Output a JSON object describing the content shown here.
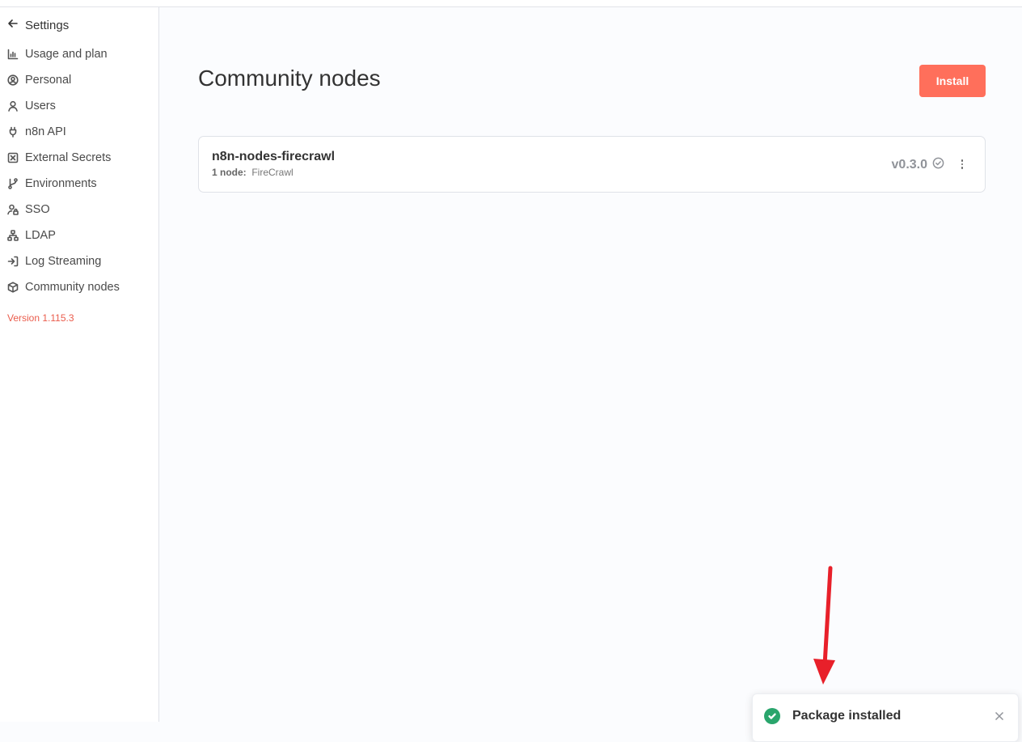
{
  "sidebar": {
    "back_label": "Settings",
    "items": [
      {
        "label": "Usage and plan",
        "icon": "chart-bar-icon"
      },
      {
        "label": "Personal",
        "icon": "user-circle-icon"
      },
      {
        "label": "Users",
        "icon": "user-icon"
      },
      {
        "label": "n8n API",
        "icon": "plug-icon"
      },
      {
        "label": "External Secrets",
        "icon": "square-x-icon"
      },
      {
        "label": "Environments",
        "icon": "git-branch-icon"
      },
      {
        "label": "SSO",
        "icon": "user-lock-icon"
      },
      {
        "label": "LDAP",
        "icon": "network-icon"
      },
      {
        "label": "Log Streaming",
        "icon": "sign-in-icon"
      },
      {
        "label": "Community nodes",
        "icon": "cube-icon"
      }
    ],
    "version": "Version 1.115.3"
  },
  "main": {
    "title": "Community nodes",
    "install_label": "Install",
    "packages": [
      {
        "name": "n8n-nodes-firecrawl",
        "count": "1 node:",
        "nodes": "FireCrawl",
        "version": "v0.3.0"
      }
    ]
  },
  "toast": {
    "message": "Package installed"
  },
  "colors": {
    "accent": "#ff6f5b",
    "version_text": "#ea5c4c",
    "success": "#29a56c",
    "annotation_arrow": "#e8202a"
  }
}
